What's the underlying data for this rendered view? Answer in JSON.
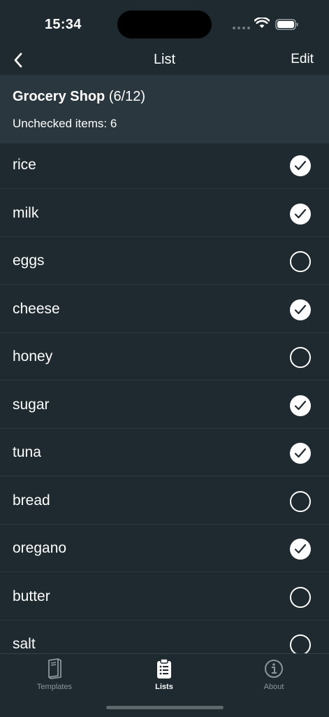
{
  "status": {
    "time": "15:34"
  },
  "nav": {
    "title": "List",
    "edit_label": "Edit"
  },
  "list": {
    "name": "Grocery Shop",
    "progress": "(6/12)",
    "unchecked_text": "Unchecked items: 6"
  },
  "items": [
    {
      "label": "rice",
      "checked": true
    },
    {
      "label": "milk",
      "checked": true
    },
    {
      "label": "eggs",
      "checked": false
    },
    {
      "label": "cheese",
      "checked": true
    },
    {
      "label": "honey",
      "checked": false
    },
    {
      "label": "sugar",
      "checked": true
    },
    {
      "label": "tuna",
      "checked": true
    },
    {
      "label": "bread",
      "checked": false
    },
    {
      "label": "oregano",
      "checked": true
    },
    {
      "label": "butter",
      "checked": false
    },
    {
      "label": "salt",
      "checked": false
    }
  ],
  "tabs": [
    {
      "label": "Templates",
      "icon": "book-icon",
      "active": false
    },
    {
      "label": "Lists",
      "icon": "clipboard-list-icon",
      "active": true
    },
    {
      "label": "About",
      "icon": "info-icon",
      "active": false
    }
  ],
  "colors": {
    "background": "#1f2a30",
    "header_background": "#2a373e",
    "foreground": "#ffffff",
    "inactive_tab": "#8b959a"
  }
}
